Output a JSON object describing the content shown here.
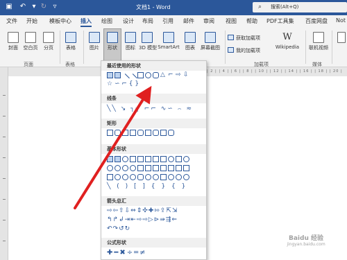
{
  "titlebar": {
    "doc_title": "文档1 - Word",
    "search": "搜索(Alt+Q)"
  },
  "tabs": [
    "文件",
    "开始",
    "模板中心",
    "插入",
    "绘图",
    "设计",
    "布局",
    "引用",
    "邮件",
    "审阅",
    "视图",
    "帮助",
    "PDF工具集",
    "百度网盘",
    "Not"
  ],
  "ribbon": {
    "cover": "封面",
    "blank": "空白页",
    "pagebreak": "分页",
    "table": "表格",
    "picture": "图片",
    "shapes": "形状",
    "icons": "图标",
    "model3d": "3D 模型",
    "smartart": "SmartArt",
    "chart": "图表",
    "screenshot": "屏幕截图",
    "get_addins": "获取加载项",
    "my_addins": "我的加载项",
    "wikipedia": "Wikipedia",
    "online_video": "联机视频",
    "groups": {
      "pages": "页面",
      "tables": "表格",
      "addins": "加载项",
      "media": "媒体"
    }
  },
  "dropdown": {
    "recent": "最近使用的形状",
    "lines": "线条",
    "rect": "矩形",
    "basic": "基本形状",
    "arrows": "箭头总汇",
    "formula": "公式形状"
  },
  "ruler_text": "| 2 | | 4 | | 6 | | 8 | | 10 | | 12 | | 14 | | 16 | | 18 | | 20 |",
  "watermark": {
    "brand": "Baidu 经验",
    "url": "jingyan.baidu.com"
  },
  "colors": {
    "accent": "#2b579a",
    "arrow": "#e02020"
  }
}
